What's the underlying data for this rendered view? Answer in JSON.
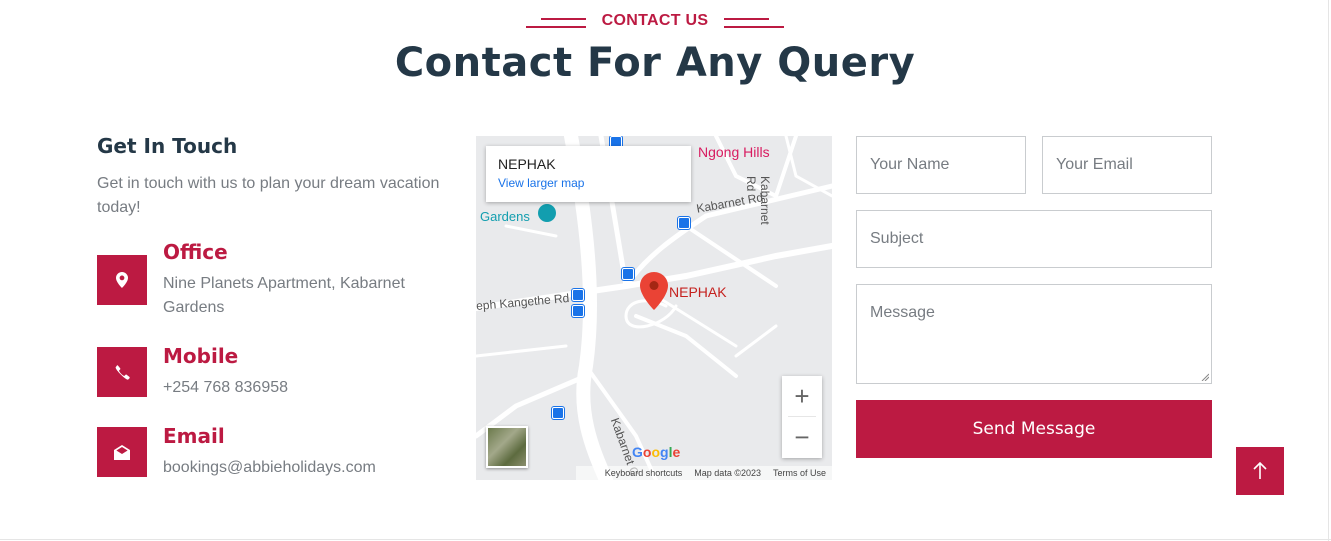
{
  "section": {
    "label": "CONTACT US",
    "title": "Contact For Any Query"
  },
  "info": {
    "title": "Get In Touch",
    "description": "Get in touch with us to plan your dream vacation today!",
    "items": [
      {
        "heading": "Office",
        "value": "Nine Planets Apartment, Kabarnet Gardens",
        "icon": "map-marker-icon"
      },
      {
        "heading": "Mobile",
        "value": "+254 768 836958",
        "icon": "phone-icon"
      },
      {
        "heading": "Email",
        "value": "bookings@abbieholidays.com",
        "icon": "envelope-open-icon"
      }
    ]
  },
  "map": {
    "place_name": "NEPHAK",
    "view_larger": "View larger map",
    "marker_label": "NEPHAK",
    "labels": {
      "ngong_hills": "Ngong Hills",
      "gardens": "Gardens",
      "kabarnet_rd": "Kabarnet Rd",
      "kabarnet_rd_vertical": "Kabarnet Rd",
      "kangethe_rd": "eph Kangethe Rd",
      "kabarnet_bottom": "Kabarnet C"
    },
    "zoom_in": "+",
    "zoom_out": "−",
    "logo": "Google",
    "attribution": [
      "Keyboard shortcuts",
      "Map data ©2023",
      "Terms of Use"
    ]
  },
  "form": {
    "name_placeholder": "Your Name",
    "email_placeholder": "Your Email",
    "subject_placeholder": "Subject",
    "message_placeholder": "Message",
    "submit_label": "Send Message"
  },
  "colors": {
    "accent": "#bc1a42",
    "heading": "#243847",
    "muted": "#777c82"
  }
}
